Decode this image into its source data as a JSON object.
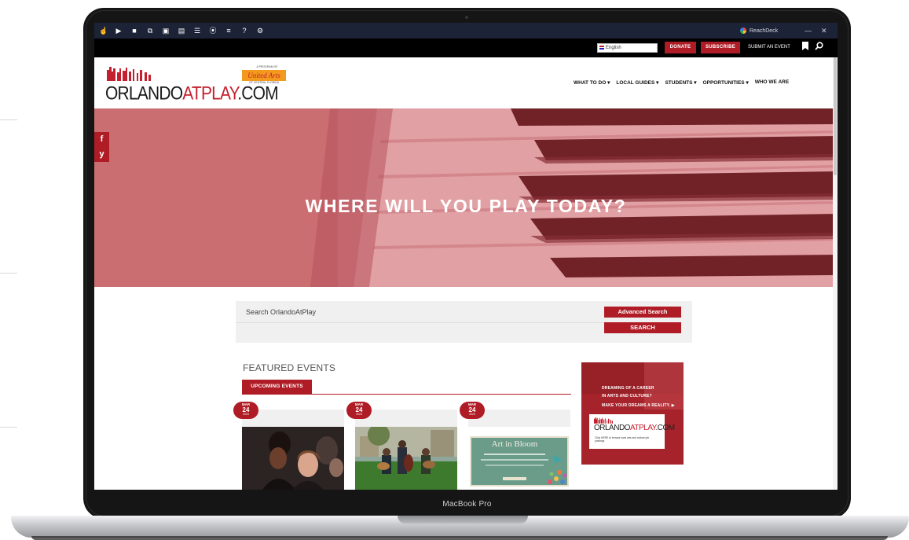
{
  "device": {
    "label": "MacBook Pro"
  },
  "extension_bar": {
    "icons": [
      "hand-icon",
      "play-icon",
      "stop-icon",
      "copy-icon",
      "picture-icon",
      "save-icon",
      "ruler-icon",
      "chat-icon",
      "text-icon",
      "help-icon",
      "settings-icon"
    ],
    "icon_glyphs": [
      "☝",
      "▶",
      "■",
      "⧉",
      "▣",
      "▤",
      "☰",
      "⦿",
      "≡",
      "?",
      "⚙"
    ],
    "brand": "ReachDeck",
    "minimize": "—",
    "close": "✕"
  },
  "util_bar": {
    "language": "English",
    "donate": "DONATE",
    "subscribe": "SUBSCRIBE",
    "submit_event": "SUBMIT AN EVENT"
  },
  "header": {
    "logo_prefix": "ORLANDO",
    "logo_highlight": "ATPLAY",
    "logo_suffix": ".COM",
    "program_of": "A PROGRAM OF",
    "partner_logo": "United Arts",
    "partner_sub": "OF CENTRAL FLORIDA",
    "nav": [
      {
        "label": "WHAT TO DO ▾"
      },
      {
        "label": "LOCAL GUIDES ▾"
      },
      {
        "label": "STUDENTS ▾"
      },
      {
        "label": "OPPORTUNITIES ▾"
      },
      {
        "label": "WHO WE ARE"
      }
    ]
  },
  "hero": {
    "title": "WHERE WILL YOU PLAY TODAY?",
    "social": [
      "f",
      "y"
    ]
  },
  "search": {
    "placeholder": "Search OrlandoAtPlay",
    "advanced": "Advanced Search",
    "submit": "SEARCH"
  },
  "featured": {
    "title": "FEATURED EVENTS",
    "tab": "UPCOMING EVENTS",
    "events": [
      {
        "month": "MAR",
        "day": "24",
        "year": "2023"
      },
      {
        "month": "MAR",
        "day": "24",
        "year": "2023"
      },
      {
        "month": "MAR",
        "day": "24",
        "year": "2023",
        "image_title": "Art in Bloom"
      }
    ]
  },
  "ad": {
    "line1": "DREAMING OF A CAREER",
    "line2": "IN ARTS AND CULTURE?",
    "line3": "MAKE YOUR DREAMS A REALITY.",
    "logo_prefix": "ORLANDO",
    "logo_highlight": "ATPLAY",
    "logo_suffix": ".COM",
    "small": "Click HERE to browse local arts and culture job postings"
  },
  "colors": {
    "brand_red": "#b01c26",
    "toolbar_navy": "#1d2337",
    "hero_tint": "#d98f92"
  }
}
